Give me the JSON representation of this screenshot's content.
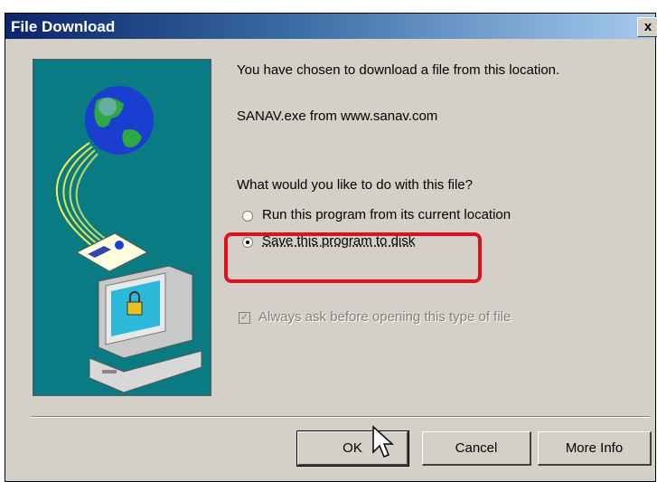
{
  "window": {
    "title": "File Download",
    "close_label": "x"
  },
  "message": {
    "intro": "You have chosen to download a file from this location.",
    "file": "SANAV.exe from www.sanav.com",
    "question": "What would you like to do with this file?"
  },
  "options": [
    {
      "label": "Run this program from its current location",
      "selected": false
    },
    {
      "label": "Save this program to disk",
      "selected": true
    }
  ],
  "checkbox": {
    "label": "Always ask before opening this type of file",
    "checked": true,
    "enabled": false
  },
  "buttons": {
    "ok": "OK",
    "cancel": "Cancel",
    "more_info": "More Info"
  },
  "colors": {
    "title_bar": "#0a246a",
    "dialog_bg": "#d4d0c8",
    "art_bg": "#0a7b82",
    "highlight": "#e0101a"
  }
}
